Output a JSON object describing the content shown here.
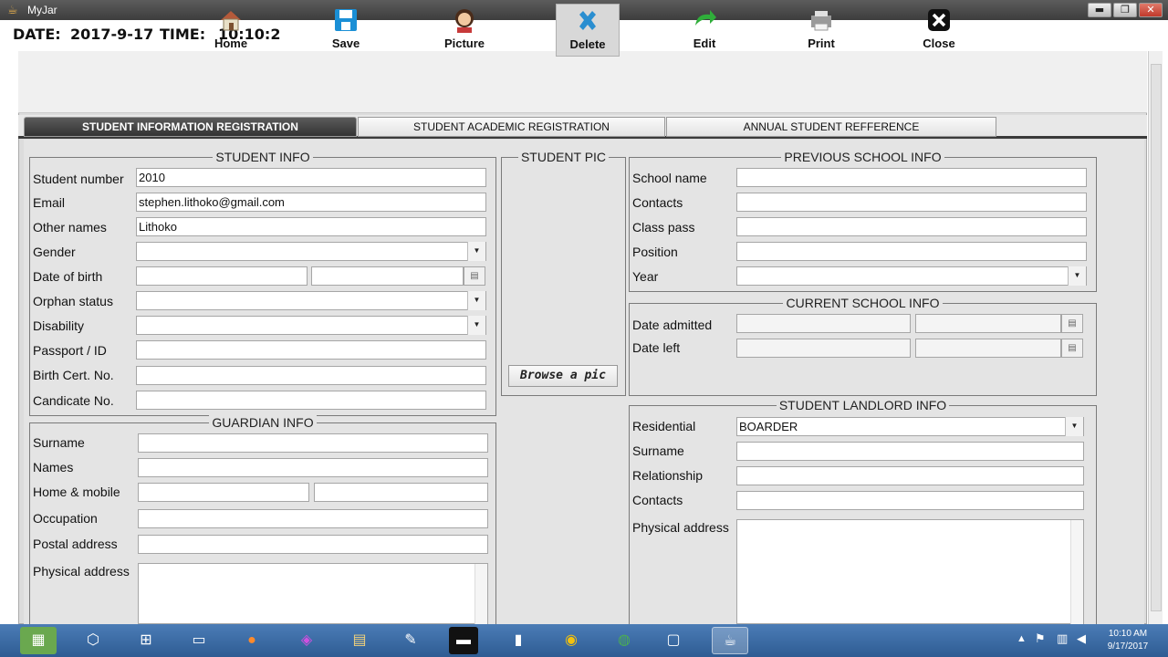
{
  "window": {
    "title": "MyJar",
    "minimize": "▬",
    "maximize": "❐",
    "close": "✕"
  },
  "datebar": {
    "date_label": "DATE:",
    "date_value": "2017-9-17",
    "time_label": "TIME:",
    "time_value": "10:10:2"
  },
  "toolbar": {
    "home": "Home",
    "save": "Save",
    "picture": "Picture",
    "delete": "Delete",
    "edit": "Edit",
    "print": "Print",
    "close": "Close"
  },
  "tabs": [
    "STUDENT INFORMATION REGISTRATION",
    "STUDENT ACADEMIC REGISTRATION",
    "ANNUAL STUDENT REFFERENCE"
  ],
  "student_info": {
    "title": "STUDENT INFO",
    "labels": {
      "student_number": "Student number",
      "email": "Email",
      "other_names": "Other names",
      "gender": "Gender",
      "dob": "Date of birth",
      "orphan": "Orphan status",
      "disability": "Disability",
      "passport": "Passport / ID",
      "birth_cert": "Birth Cert. No.",
      "candidate": "Candicate No."
    },
    "values": {
      "student_number": "2010",
      "email": "stephen.lithoko@gmail.com",
      "other_names": "Lithoko",
      "gender": "",
      "dob_1": "",
      "dob_2": "",
      "orphan": "",
      "disability": "",
      "passport": "",
      "birth_cert": "",
      "candidate": ""
    }
  },
  "guardian_info": {
    "title": "GUARDIAN INFO",
    "labels": {
      "surname": "Surname",
      "names": "Names",
      "home_mobile": "Home & mobile",
      "occupation": "Occupation",
      "postal": "Postal address",
      "physical": "Physical address"
    }
  },
  "student_pic": {
    "title": "STUDENT PIC",
    "browse": "Browse a pic"
  },
  "previous_school": {
    "title": "PREVIOUS SCHOOL INFO",
    "labels": {
      "school_name": "School name",
      "contacts": "Contacts",
      "class_pass": "Class pass",
      "position": "Position",
      "year": "Year"
    }
  },
  "current_school": {
    "title": "CURRENT SCHOOL INFO",
    "labels": {
      "date_admitted": "Date admitted",
      "date_left": "Date left"
    }
  },
  "landlord_info": {
    "title": "STUDENT LANDLORD INFO",
    "labels": {
      "residential": "Residential",
      "surname": "Surname",
      "relationship": "Relationship",
      "contacts": "Contacts",
      "physical": "Physical address"
    },
    "values": {
      "residential": "BOARDER"
    }
  },
  "taskbar": {
    "icons": [
      "cube-icon",
      "network-icon",
      "folder-icon",
      "firefox-icon",
      "app-icon",
      "files-icon",
      "paint-icon",
      "terminal-icon",
      "book-icon",
      "chrome-icon",
      "globe-icon",
      "window-icon",
      "java-icon"
    ],
    "clock_time": "10:10 AM",
    "clock_date": "9/17/2017"
  },
  "colors": {
    "title_bar": "#3d3d3d",
    "taskbar": "#2e5c93",
    "tab_selected": "#333333",
    "panel_bg": "#e4e4e4"
  }
}
